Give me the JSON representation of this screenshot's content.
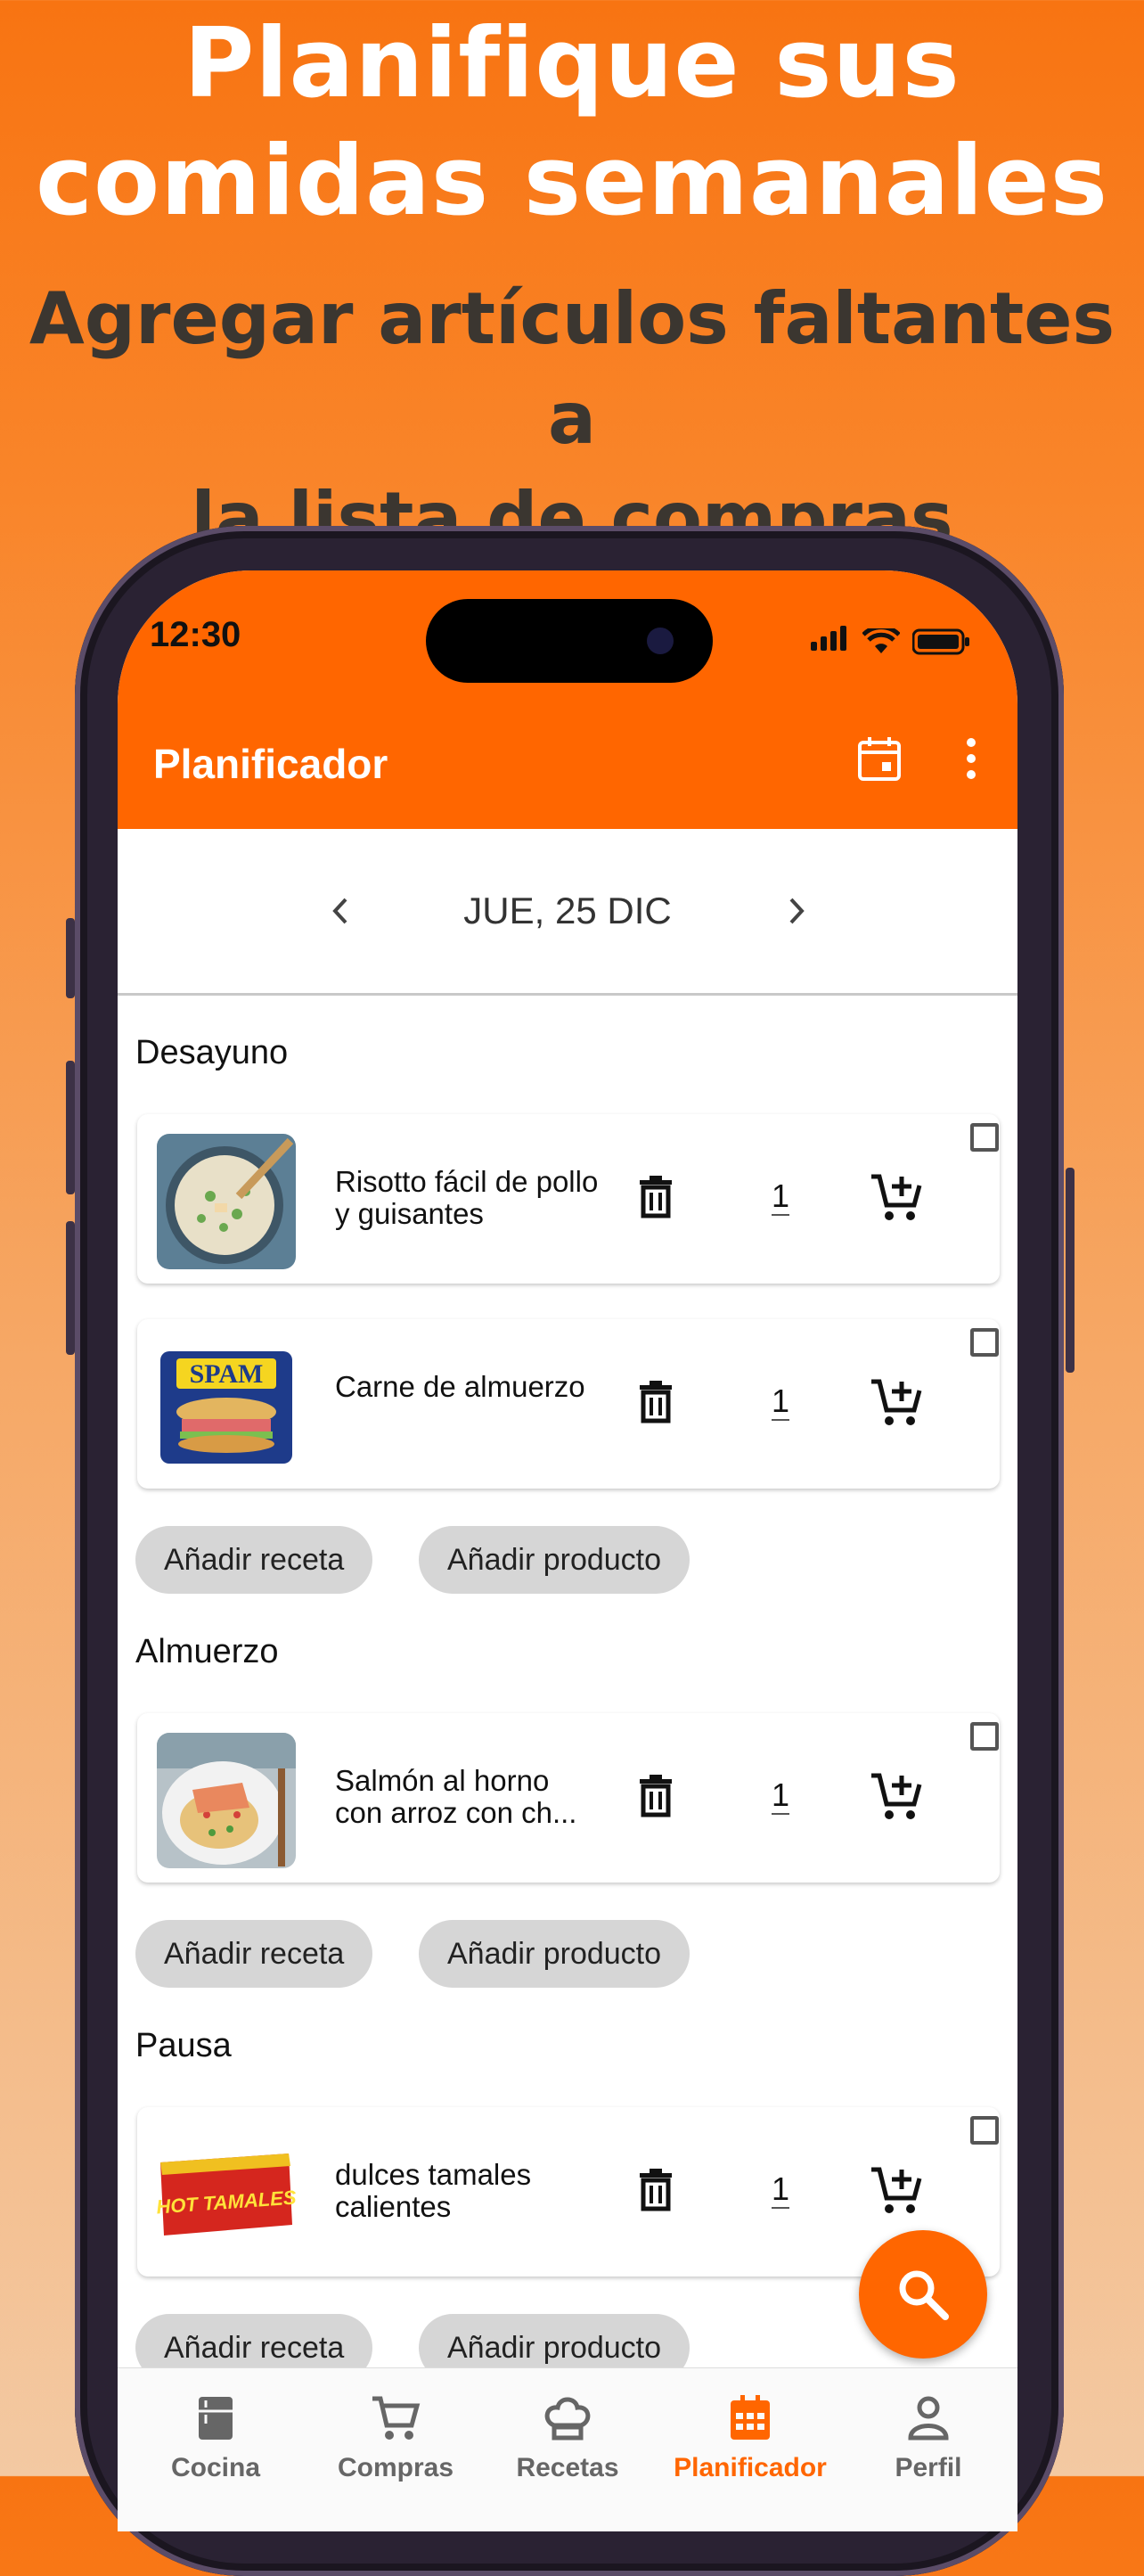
{
  "promo": {
    "headline": [
      "Planifique sus",
      "comidas semanales"
    ],
    "subhead": [
      "Agregar artículos faltantes a",
      "la lista de compras"
    ]
  },
  "status_bar": {
    "time": "12:30"
  },
  "app_bar": {
    "title": "Planificador",
    "icons": [
      "calendar-icon",
      "more-vert-icon"
    ]
  },
  "date_nav": {
    "label": "JUE, 25 DIC"
  },
  "sections": [
    {
      "title": "Desayuno",
      "items": [
        {
          "name": "Risotto fácil de pollo y guisantes",
          "quantity": "1",
          "image": "risotto-image"
        },
        {
          "name": "Carne de almuerzo",
          "quantity": "1",
          "image": "spam-image"
        }
      ]
    },
    {
      "title": "Almuerzo",
      "items": [
        {
          "name": "Salmón al horno con arroz con ch...",
          "quantity": "1",
          "image": "salmon-image"
        }
      ]
    },
    {
      "title": "Pausa",
      "items": [
        {
          "name": "dulces tamales calientes",
          "quantity": "1",
          "image": "hot-tamales-image"
        }
      ]
    }
  ],
  "chips": {
    "add_recipe": "Añadir receta",
    "add_product": "Añadir producto"
  },
  "product_labels": {
    "spam": "SPAM",
    "hot_tamales": "HOT TAMALES"
  },
  "bottom_nav": [
    {
      "label": "Cocina",
      "icon": "kitchen-icon"
    },
    {
      "label": "Compras",
      "icon": "cart-icon"
    },
    {
      "label": "Recetas",
      "icon": "chef-hat-icon"
    },
    {
      "label": "Planificador",
      "icon": "calendar-icon",
      "active": true
    },
    {
      "label": "Perfil",
      "icon": "person-icon"
    }
  ],
  "colors": {
    "accent": "#ff6600",
    "headline": "#ffffff",
    "subhead": "#3b3630"
  }
}
